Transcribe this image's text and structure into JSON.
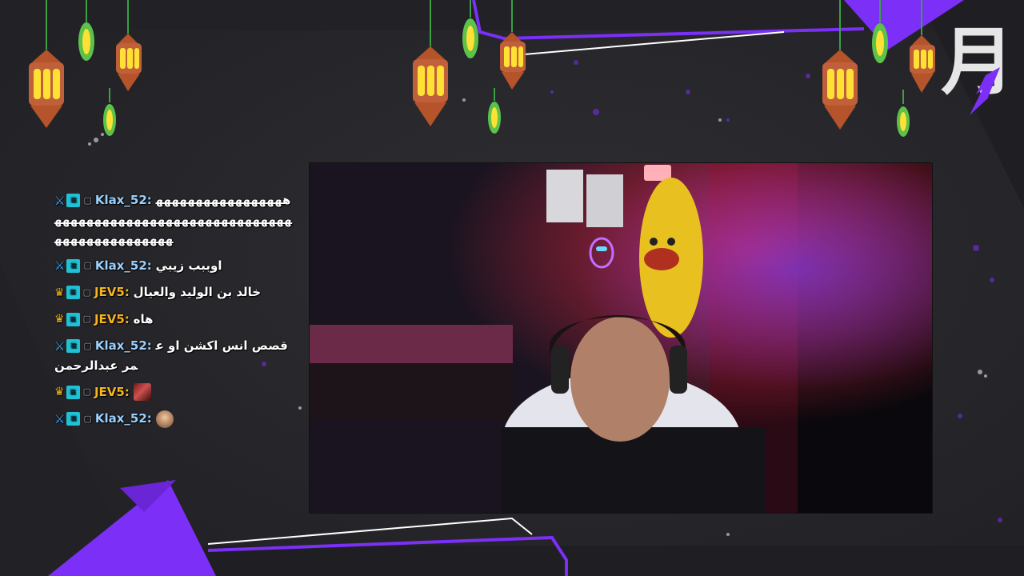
{
  "chat": {
    "messages": [
      {
        "badges": [
          "sword",
          "sub",
          "tag"
        ],
        "user": "Klax_52:",
        "user_color": "blue",
        "text": "ﻫﻬﻬﻬﻬﻬﻬﻬﻬﻬﻬﻬﻬﻬﻬﻬﻬﻬﻬﻬﻬﻬﻬﻬﻬﻬﻬﻬﻬﻬﻬﻬﻬﻬﻬﻬﻬﻬﻬﻬﻬﻬﻬﻬﻬﻬﻬﻬﻬﻬﻬﻬﻬﻬﻬﻬﻬﻬﻬﻬﻬﻬ"
      },
      {
        "badges": [
          "sword",
          "sub",
          "tag"
        ],
        "user": "Klax_52:",
        "user_color": "blue",
        "text": "اوببب زيبي"
      },
      {
        "badges": [
          "crown",
          "sub",
          "tag"
        ],
        "user": "JEV5:",
        "user_color": "gold",
        "text": "خالد بن الوليد والعيال"
      },
      {
        "badges": [
          "crown",
          "sub",
          "tag"
        ],
        "user": "JEV5:",
        "user_color": "gold",
        "text": "هاه"
      },
      {
        "badges": [
          "sword",
          "sub",
          "tag"
        ],
        "user": "Klax_52:",
        "user_color": "blue",
        "text": "قصص انس اكشن او عمر عبدالرحمن"
      },
      {
        "badges": [
          "crown",
          "sub",
          "tag"
        ],
        "user": "JEV5:",
        "user_color": "gold",
        "emote": "emote-a"
      },
      {
        "badges": [
          "sword",
          "sub",
          "tag"
        ],
        "user": "Klax_52:",
        "user_color": "blue",
        "emote": "emote-b"
      }
    ]
  },
  "overlay": {
    "logo_glyph": "月",
    "accent_color": "#7b2ff7",
    "background_color": "#27272b"
  }
}
